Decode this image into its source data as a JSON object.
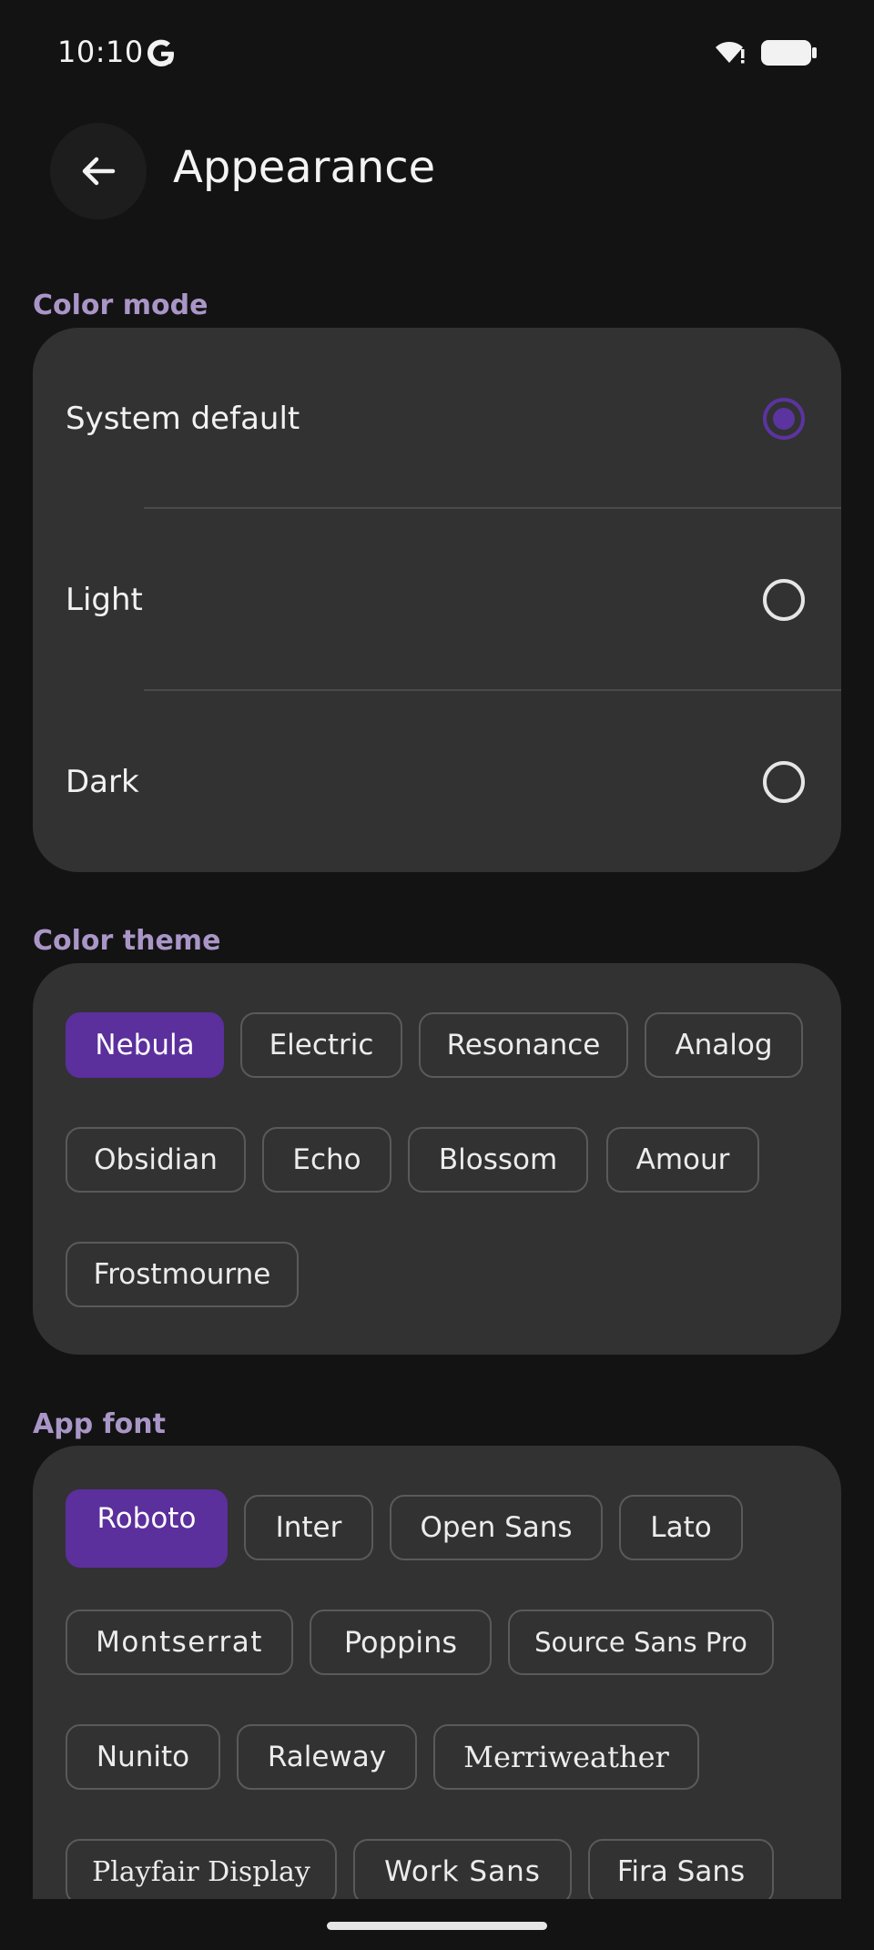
{
  "status_bar": {
    "time": "10:10",
    "icons": [
      "google-g-icon",
      "wifi-icon",
      "battery-icon"
    ]
  },
  "header": {
    "title": "Appearance",
    "back_icon": "arrow-left-icon"
  },
  "color_mode": {
    "label": "Color mode",
    "options": [
      {
        "label": "System default",
        "selected": true
      },
      {
        "label": "Light",
        "selected": false
      },
      {
        "label": "Dark",
        "selected": false
      }
    ]
  },
  "color_theme": {
    "label": "Color theme",
    "chips": [
      "Nebula",
      "Electric",
      "Resonance",
      "Analog",
      "Obsidian",
      "Echo",
      "Blossom",
      "Amour",
      "Frostmourne"
    ],
    "selected": "Nebula"
  },
  "app_font": {
    "label": "App font",
    "chips": [
      "Roboto",
      "Inter",
      "Open Sans",
      "Lato",
      "Montserrat",
      "Poppins",
      "Source Sans Pro",
      "Nunito",
      "Raleway",
      "Merriweather",
      "Playfair Display",
      "Work Sans",
      "Fira Sans"
    ],
    "selected": "Roboto"
  },
  "colors": {
    "background": "#131313",
    "card": "#323232",
    "accent": "#5b2f9c",
    "section_label": "#a996c7"
  }
}
